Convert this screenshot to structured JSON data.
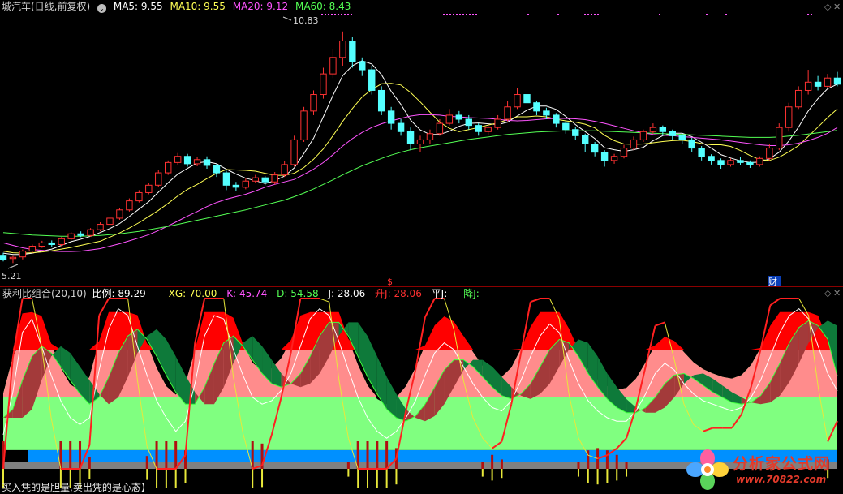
{
  "header": {
    "title": "城汽车(日线,前复权)",
    "ma5_label": "MA5:",
    "ma5": "9.55",
    "ma10_label": "MA10:",
    "ma10": "9.55",
    "ma20_label": "MA20:",
    "ma20": "9.12",
    "ma60_label": "MA60:",
    "ma60": "8.43"
  },
  "price_marks": {
    "high": "10.83",
    "low": "5.21"
  },
  "event_marks": {
    "dividend": "$",
    "finance": "财"
  },
  "indicator": {
    "title": "获利比组合(20,10)",
    "ratio_label": "比例:",
    "ratio": "89.29",
    "xg_label": "XG:",
    "xg": "70.00",
    "k_label": "K:",
    "k": "45.74",
    "d_label": "D:",
    "d": "54.58",
    "j_label": "J:",
    "j": "28.06",
    "up_label": "升J:",
    "up": "28.06",
    "flat_label": "平J:",
    "flat": "-",
    "down_label": "降J:",
    "down": "-"
  },
  "footer": "买入凭的是胆量,卖出凭的是心态】",
  "watermark": {
    "name": "分析家公式网",
    "url": "www.70822.com"
  },
  "controls": {
    "diamond": "◇",
    "close": "✕"
  },
  "colors": {
    "up": "#ff3232",
    "down": "#54ffff",
    "ma5": "#ffffff",
    "ma10": "#ffff54",
    "ma20": "#ff54ff",
    "ma60": "#54ff54",
    "band_top": "#ff0000",
    "band_mid": "#ff8c8c",
    "band_green": "#80ff80",
    "band_blue": "#0090ff",
    "band_gray": "#808080"
  },
  "chart_data": [
    {
      "type": "candlestick",
      "title": "城汽车(日线,前复权)",
      "ylim": [
        5.0,
        11.2
      ],
      "candles": [
        [
          5.4,
          5.3,
          5.46,
          5.25
        ],
        [
          5.32,
          5.35,
          5.4,
          5.21
        ],
        [
          5.36,
          5.5,
          5.54,
          5.3
        ],
        [
          5.5,
          5.62,
          5.66,
          5.45
        ],
        [
          5.62,
          5.7,
          5.75,
          5.58
        ],
        [
          5.7,
          5.66,
          5.76,
          5.6
        ],
        [
          5.66,
          5.8,
          5.84,
          5.62
        ],
        [
          5.8,
          5.92,
          5.96,
          5.76
        ],
        [
          5.92,
          5.88,
          5.98,
          5.84
        ],
        [
          5.88,
          6.02,
          6.06,
          5.85
        ],
        [
          6.02,
          6.15,
          6.2,
          5.98
        ],
        [
          6.15,
          6.3,
          6.36,
          6.1
        ],
        [
          6.3,
          6.5,
          6.55,
          6.26
        ],
        [
          6.5,
          6.72,
          6.78,
          6.46
        ],
        [
          6.72,
          6.92,
          6.98,
          6.68
        ],
        [
          6.92,
          7.1,
          7.15,
          6.88
        ],
        [
          7.1,
          7.4,
          7.48,
          7.06
        ],
        [
          7.4,
          7.65,
          7.7,
          7.35
        ],
        [
          7.65,
          7.8,
          7.88,
          7.6
        ],
        [
          7.8,
          7.62,
          7.86,
          7.55
        ],
        [
          7.62,
          7.72,
          7.78,
          7.56
        ],
        [
          7.72,
          7.58,
          7.8,
          7.5
        ],
        [
          7.58,
          7.4,
          7.62,
          7.3
        ],
        [
          7.4,
          7.1,
          7.45,
          6.98
        ],
        [
          7.1,
          7.05,
          7.18,
          6.95
        ],
        [
          7.05,
          7.2,
          7.26,
          7.0
        ],
        [
          7.2,
          7.28,
          7.35,
          7.15
        ],
        [
          7.28,
          7.18,
          7.32,
          7.1
        ],
        [
          7.18,
          7.35,
          7.42,
          7.12
        ],
        [
          7.35,
          7.6,
          7.68,
          7.3
        ],
        [
          7.6,
          8.2,
          8.3,
          7.55
        ],
        [
          8.2,
          8.9,
          9.0,
          8.15
        ],
        [
          8.9,
          9.3,
          9.4,
          8.8
        ],
        [
          9.3,
          9.8,
          9.95,
          9.2
        ],
        [
          9.8,
          10.2,
          10.4,
          9.7
        ],
        [
          10.2,
          10.6,
          10.83,
          10.0
        ],
        [
          10.6,
          10.1,
          10.7,
          9.95
        ],
        [
          10.1,
          9.9,
          10.2,
          9.75
        ],
        [
          9.9,
          9.4,
          10.0,
          9.3
        ],
        [
          9.4,
          8.9,
          9.5,
          8.8
        ],
        [
          8.9,
          8.6,
          9.0,
          8.45
        ],
        [
          8.6,
          8.4,
          8.7,
          8.3
        ],
        [
          8.4,
          8.1,
          8.5,
          7.95
        ],
        [
          8.1,
          8.2,
          8.3,
          7.9
        ],
        [
          8.2,
          8.35,
          8.45,
          8.1
        ],
        [
          8.35,
          8.6,
          8.7,
          8.3
        ],
        [
          8.6,
          8.8,
          8.95,
          8.55
        ],
        [
          8.8,
          8.7,
          8.9,
          8.6
        ],
        [
          8.7,
          8.55,
          8.8,
          8.45
        ],
        [
          8.55,
          8.4,
          8.6,
          8.3
        ],
        [
          8.4,
          8.5,
          8.58,
          8.32
        ],
        [
          8.5,
          8.7,
          8.8,
          8.45
        ],
        [
          8.7,
          9.0,
          9.15,
          8.65
        ],
        [
          9.0,
          9.3,
          9.45,
          8.95
        ],
        [
          9.3,
          9.1,
          9.38,
          9.0
        ],
        [
          9.1,
          8.9,
          9.15,
          8.8
        ],
        [
          8.9,
          8.8,
          8.98,
          8.7
        ],
        [
          8.8,
          8.6,
          8.85,
          8.5
        ],
        [
          8.6,
          8.45,
          8.65,
          8.35
        ],
        [
          8.45,
          8.3,
          8.52,
          8.2
        ],
        [
          8.3,
          8.1,
          8.35,
          7.9
        ],
        [
          8.1,
          7.9,
          8.15,
          7.8
        ],
        [
          7.9,
          7.7,
          7.95,
          7.55
        ],
        [
          7.7,
          7.8,
          7.86,
          7.62
        ],
        [
          7.8,
          8.0,
          8.08,
          7.75
        ],
        [
          8.0,
          8.2,
          8.28,
          7.95
        ],
        [
          8.2,
          8.4,
          8.45,
          8.15
        ],
        [
          8.4,
          8.5,
          8.6,
          8.35
        ],
        [
          8.5,
          8.4,
          8.55,
          8.3
        ],
        [
          8.4,
          8.3,
          8.45,
          8.2
        ],
        [
          8.3,
          8.2,
          8.36,
          8.1
        ],
        [
          8.2,
          8.0,
          8.25,
          7.9
        ],
        [
          8.0,
          7.8,
          8.05,
          7.7
        ],
        [
          7.8,
          7.7,
          7.85,
          7.6
        ],
        [
          7.7,
          7.6,
          7.75,
          7.5
        ],
        [
          7.6,
          7.7,
          7.75,
          7.55
        ],
        [
          7.7,
          7.65,
          7.78,
          7.58
        ],
        [
          7.65,
          7.6,
          7.7,
          7.52
        ],
        [
          7.6,
          7.75,
          7.8,
          7.55
        ],
        [
          7.75,
          8.0,
          8.1,
          7.7
        ],
        [
          8.0,
          8.5,
          8.6,
          7.95
        ],
        [
          8.5,
          9.0,
          9.1,
          8.4
        ],
        [
          9.0,
          9.4,
          9.5,
          8.95
        ],
        [
          9.4,
          9.6,
          9.9,
          9.3
        ],
        [
          9.6,
          9.5,
          9.75,
          9.4
        ],
        [
          9.5,
          9.7,
          9.8,
          9.45
        ],
        [
          9.7,
          9.55,
          9.85,
          9.5
        ]
      ],
      "series": [
        {
          "name": "MA5",
          "values": [
            5.45,
            5.42,
            5.42,
            5.45,
            5.5,
            5.55,
            5.64,
            5.73,
            5.79,
            5.86,
            5.95,
            6.05,
            6.17,
            6.34,
            6.52,
            6.7,
            6.93,
            7.16,
            7.37,
            7.51,
            7.64,
            7.67,
            7.62,
            7.49,
            7.37,
            7.27,
            7.21,
            7.14,
            7.21,
            7.32,
            7.52,
            7.87,
            8.24,
            8.76,
            9.28,
            9.76,
            10.0,
            10.12,
            10.04,
            9.78,
            9.38,
            9.06,
            8.68,
            8.44,
            8.33,
            8.33,
            8.41,
            8.53,
            8.6,
            8.61,
            8.59,
            8.57,
            8.63,
            8.78,
            8.92,
            9.02,
            9.02,
            8.94,
            8.77,
            8.57,
            8.4,
            8.23,
            8.01,
            7.96,
            7.92,
            7.96,
            8.02,
            8.18,
            8.3,
            8.36,
            8.36,
            8.28,
            8.14,
            8.0,
            7.84,
            7.76,
            7.69,
            7.65,
            7.66,
            7.74,
            7.9,
            8.17,
            8.51,
            8.9,
            9.2,
            9.44,
            9.55
          ]
        },
        {
          "name": "MA10",
          "values": [
            5.5,
            5.46,
            5.45,
            5.46,
            5.48,
            5.51,
            5.55,
            5.59,
            5.64,
            5.69,
            5.74,
            5.84,
            5.94,
            6.06,
            6.19,
            6.34,
            6.49,
            6.66,
            6.84,
            7.0,
            7.12,
            7.26,
            7.39,
            7.48,
            7.47,
            7.46,
            7.44,
            7.39,
            7.34,
            7.34,
            7.39,
            7.53,
            7.73,
            7.98,
            8.3,
            8.65,
            8.96,
            9.24,
            9.42,
            9.56,
            9.57,
            9.53,
            9.35,
            9.12,
            8.87,
            8.63,
            8.48,
            8.4,
            8.45,
            8.5,
            8.56,
            8.61,
            8.69,
            8.76,
            8.76,
            8.78,
            8.76,
            8.7,
            8.66,
            8.63,
            8.58,
            8.49,
            8.31,
            8.18,
            8.1,
            8.09,
            8.1,
            8.13,
            8.16,
            8.18,
            8.19,
            8.16,
            8.11,
            8.08,
            8.08,
            8.04,
            7.94,
            7.82,
            7.72,
            7.7,
            7.78,
            7.91,
            8.06,
            8.28,
            8.51,
            8.74,
            8.95
          ]
        },
        {
          "name": "MA20",
          "values": [
            5.7,
            5.64,
            5.58,
            5.54,
            5.52,
            5.5,
            5.49,
            5.49,
            5.5,
            5.53,
            5.56,
            5.62,
            5.68,
            5.75,
            5.82,
            5.9,
            6.0,
            6.11,
            6.23,
            6.35,
            6.46,
            6.58,
            6.68,
            6.76,
            6.82,
            6.88,
            6.96,
            7.05,
            7.12,
            7.18,
            7.24,
            7.36,
            7.49,
            7.65,
            7.84,
            8.05,
            8.23,
            8.38,
            8.5,
            8.59,
            8.66,
            8.72,
            8.78,
            8.81,
            8.81,
            8.8,
            8.77,
            8.76,
            8.74,
            8.73,
            8.72,
            8.7,
            8.67,
            8.66,
            8.67,
            8.69,
            8.71,
            8.72,
            8.72,
            8.71,
            8.69,
            8.65,
            8.6,
            8.54,
            8.48,
            8.42,
            8.37,
            8.33,
            8.31,
            8.3,
            8.28,
            8.26,
            8.24,
            8.22,
            8.2,
            8.17,
            8.14,
            8.11,
            8.08,
            8.06,
            8.06,
            8.08,
            8.12,
            8.18,
            8.26,
            8.36,
            8.5
          ]
        },
        {
          "name": "MA60",
          "values": [
            5.95,
            5.93,
            5.91,
            5.89,
            5.88,
            5.87,
            5.86,
            5.86,
            5.86,
            5.87,
            5.88,
            5.9,
            5.92,
            5.95,
            5.98,
            6.02,
            6.06,
            6.1,
            6.15,
            6.2,
            6.25,
            6.3,
            6.35,
            6.4,
            6.45,
            6.5,
            6.56,
            6.62,
            6.68,
            6.74,
            6.82,
            6.91,
            7.01,
            7.12,
            7.23,
            7.35,
            7.46,
            7.57,
            7.66,
            7.75,
            7.83,
            7.9,
            7.96,
            8.01,
            8.05,
            8.09,
            8.13,
            8.17,
            8.21,
            8.24,
            8.27,
            8.3,
            8.33,
            8.35,
            8.37,
            8.39,
            8.4,
            8.41,
            8.42,
            8.42,
            8.42,
            8.42,
            8.41,
            8.4,
            8.39,
            8.38,
            8.37,
            8.36,
            8.35,
            8.34,
            8.33,
            8.32,
            8.31,
            8.3,
            8.29,
            8.28,
            8.27,
            8.26,
            8.26,
            8.26,
            8.27,
            8.29,
            8.31,
            8.34,
            8.37,
            8.4,
            8.43
          ]
        }
      ]
    },
    {
      "type": "area",
      "title": "获利比组合(20,10)",
      "ylim": [
        0,
        100
      ],
      "band_levels": [
        0,
        4,
        11,
        35,
        60,
        70
      ],
      "series": [
        {
          "name": "K",
          "values": [
            20,
            45,
            80,
            88,
            72,
            55,
            40,
            30,
            26,
            30,
            58,
            82,
            94,
            90,
            72,
            55,
            40,
            30,
            22,
            28,
            50,
            78,
            90,
            88,
            70,
            55,
            42,
            38,
            40,
            46,
            56,
            72,
            88,
            94,
            90,
            75,
            58,
            42,
            30,
            22,
            18,
            22,
            30,
            40,
            55,
            68,
            74,
            70,
            60,
            50,
            42,
            36,
            34,
            40,
            52,
            66,
            78,
            85,
            80,
            64,
            50,
            40,
            34,
            30,
            28,
            28,
            34,
            44,
            56,
            62,
            58,
            50,
            44,
            40,
            38,
            36,
            34,
            36,
            42,
            52,
            66,
            80,
            90,
            94,
            88,
            72,
            56,
            45.74
          ]
        },
        {
          "name": "D",
          "values": [
            30,
            35,
            52,
            66,
            72,
            68,
            60,
            52,
            44,
            38,
            42,
            54,
            68,
            78,
            82,
            76,
            66,
            55,
            45,
            38,
            38,
            48,
            62,
            74,
            78,
            72,
            64,
            56,
            50,
            48,
            50,
            56,
            66,
            78,
            86,
            86,
            78,
            66,
            54,
            44,
            35,
            30,
            28,
            31,
            38,
            48,
            58,
            64,
            64,
            60,
            54,
            48,
            43,
            41,
            44,
            50,
            60,
            70,
            76,
            74,
            66,
            56,
            48,
            41,
            36,
            33,
            33,
            36,
            42,
            50,
            55,
            56,
            53,
            49,
            45,
            42,
            39,
            38,
            39,
            43,
            51,
            62,
            74,
            83,
            87,
            84,
            76,
            54.58
          ]
        },
        {
          "name": "J",
          "values": [
            0,
            65,
            100,
            100,
            72,
            30,
            0,
            0,
            0,
            14,
            90,
            100,
            100,
            100,
            52,
            13,
            0,
            0,
            0,
            8,
            74,
            100,
            100,
            100,
            54,
            21,
            0,
            2,
            20,
            42,
            68,
            100,
            100,
            100,
            98,
            53,
            18,
            0,
            0,
            0,
            0,
            6,
            34,
            58,
            89,
            100,
            100,
            82,
            52,
            30,
            18,
            12,
            16,
            38,
            68,
            98,
            100,
            100,
            88,
            44,
            18,
            8,
            6,
            8,
            12,
            18,
            36,
            60,
            84,
            86,
            64,
            38,
            26,
            22,
            24,
            24,
            24,
            32,
            48,
            70,
            96,
            100,
            100,
            100,
            90,
            48,
            16,
            28.06
          ]
        }
      ]
    }
  ]
}
